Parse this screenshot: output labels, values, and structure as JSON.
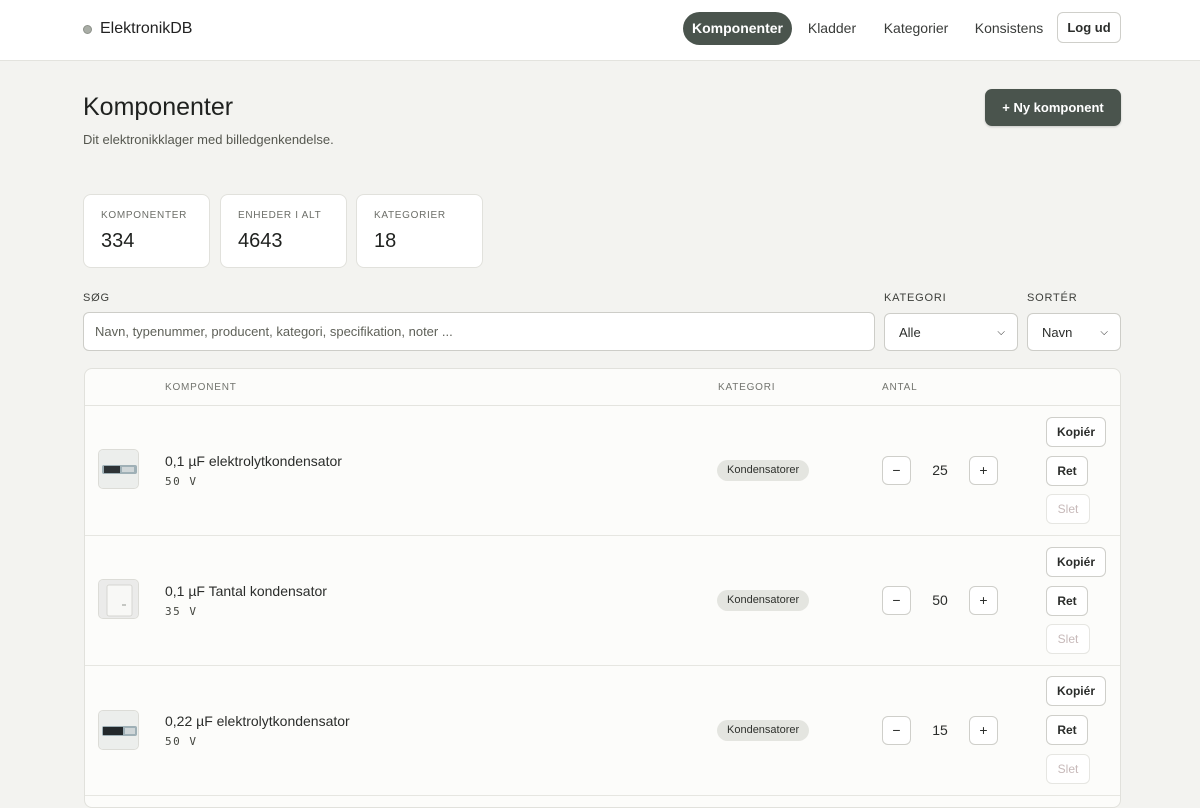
{
  "brand": {
    "name": "ElektronikDB"
  },
  "nav": {
    "items": [
      {
        "label": "Komponenter",
        "active": true
      },
      {
        "label": "Kladder",
        "active": false
      },
      {
        "label": "Kategorier",
        "active": false
      },
      {
        "label": "Konsistens",
        "active": false
      }
    ],
    "logout_label": "Log ud"
  },
  "header": {
    "title": "Komponenter",
    "subtitle": "Dit elektronikklager med billedgenkendelse.",
    "new_button_label": "+ Ny komponent"
  },
  "stats": [
    {
      "label": "KOMPONENTER",
      "value": "334"
    },
    {
      "label": "ENHEDER I ALT",
      "value": "4643"
    },
    {
      "label": "KATEGORIER",
      "value": "18"
    }
  ],
  "filters": {
    "search_label": "SØG",
    "search_placeholder": "Navn, typenummer, producent, kategori, specifikation, noter ...",
    "search_value": "",
    "category_label": "KATEGORI",
    "category_value": "Alle",
    "sort_label": "SORTÉR",
    "sort_value": "Navn"
  },
  "table": {
    "columns": {
      "component": "KOMPONENT",
      "category": "KATEGORI",
      "quantity": "ANTAL"
    },
    "minus_label": "−",
    "plus_label": "+",
    "copy_label": "Kopiér",
    "edit_label": "Ret",
    "delete_label": "Slet",
    "rows": [
      {
        "name": "0,1 µF elektrolytkondensator",
        "spec": "50 V",
        "category": "Kondensatorer",
        "quantity": "25",
        "thumb": "electrolytic-capacitor-photo"
      },
      {
        "name": "0,1 µF Tantal kondensator",
        "spec": "35 V",
        "category": "Kondensatorer",
        "quantity": "50",
        "thumb": "tantalum-capacitor-photo"
      },
      {
        "name": "0,22 µF elektrolytkondensator",
        "spec": "50 V",
        "category": "Kondensatorer",
        "quantity": "15",
        "thumb": "electrolytic-capacitor-photo"
      }
    ]
  },
  "colors": {
    "accent": "#4a544d",
    "background": "#f3f3f0",
    "surface": "#ffffff",
    "badge": "#e4e5e0",
    "disabled_text": "#c7b9b9"
  }
}
